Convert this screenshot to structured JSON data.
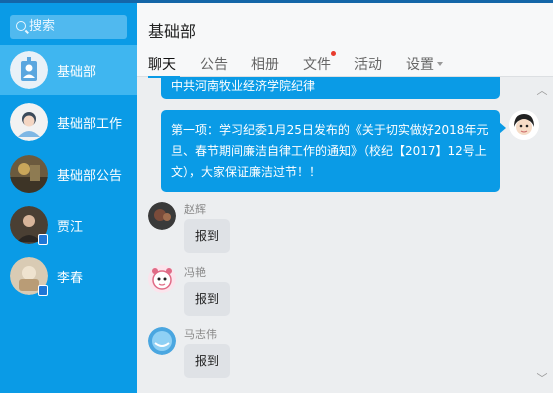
{
  "sidebar": {
    "search_placeholder": "搜索",
    "contacts": [
      {
        "name": "基础部",
        "active": true
      },
      {
        "name": "基础部工作",
        "active": false
      },
      {
        "name": "基础部公告",
        "active": false
      },
      {
        "name": "贾江",
        "active": false,
        "badge": true
      },
      {
        "name": "李春",
        "active": false,
        "badge": true
      }
    ]
  },
  "header": {
    "title": "基础部",
    "tabs": [
      "聊天",
      "公告",
      "相册",
      "文件",
      "活动",
      "设置"
    ],
    "active_tab": "聊天"
  },
  "chat": {
    "top_message": "中共河南牧业经济学院纪律",
    "main_message": "第一项：学习纪委1月25日发布的《关于切实做好2018年元旦、春节期间廉洁自律工作的通知》（校纪【2017】12号上文），大家保证廉洁过节！！",
    "messages": [
      {
        "sender": "赵辉",
        "text": "报到"
      },
      {
        "sender": "冯艳",
        "text": "报到"
      },
      {
        "sender": "马志伟",
        "text": "报到"
      }
    ]
  },
  "colors": {
    "sidebar": "#0a9be6",
    "sidebar_active": "#3fb6f0",
    "accent": "#0a9be6",
    "unread_dot": "#e83b2e"
  }
}
